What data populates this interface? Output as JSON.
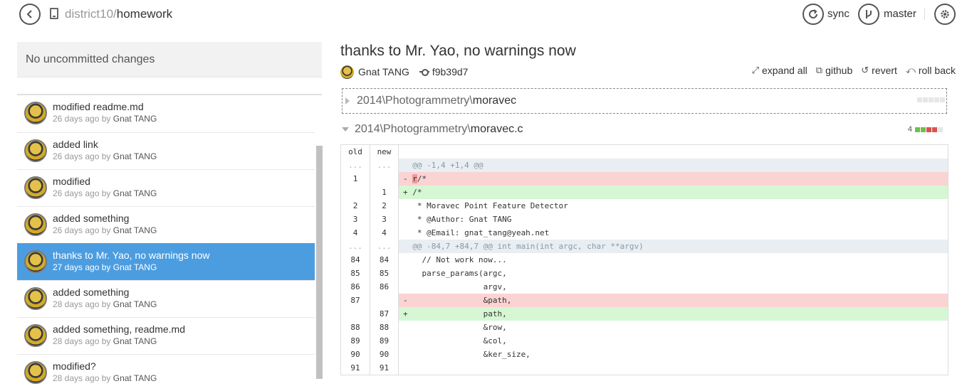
{
  "header": {
    "repo_owner": "district10",
    "repo_sep": "/",
    "repo_name": "homework",
    "sync_label": "sync",
    "branch_label": "master"
  },
  "sidebar": {
    "uncommitted": "No uncommitted changes",
    "commits": [
      {
        "message": "modified readme.md",
        "time": "26 days ago by ",
        "author": "Gnat TANG"
      },
      {
        "message": "added link",
        "time": "26 days ago by ",
        "author": "Gnat TANG"
      },
      {
        "message": "modified",
        "time": "26 days ago by ",
        "author": "Gnat TANG"
      },
      {
        "message": "added something",
        "time": "26 days ago by ",
        "author": "Gnat TANG"
      },
      {
        "message": "thanks to Mr. Yao, no warnings now",
        "time": "27 days ago by ",
        "author": "Gnat TANG"
      },
      {
        "message": "added something",
        "time": "28 days ago by ",
        "author": "Gnat TANG"
      },
      {
        "message": "added something, readme.md",
        "time": "28 days ago by ",
        "author": "Gnat TANG"
      },
      {
        "message": "modified?",
        "time": "28 days ago by ",
        "author": "Gnat TANG"
      }
    ]
  },
  "commit": {
    "title": "thanks to Mr. Yao, no warnings now",
    "author": "Gnat TANG",
    "sha": "f9b39d7",
    "actions": {
      "expand_all": "expand all",
      "github": "github",
      "revert": "revert",
      "roll_back": "roll back"
    }
  },
  "files": [
    {
      "dir": "2014\\Photogrammetry\\",
      "name": "moravec",
      "changes": ""
    },
    {
      "dir": "2014\\Photogrammetry\\",
      "name": "moravec.c",
      "changes": "4"
    }
  ],
  "diff": {
    "col_old": "old",
    "col_new": "new",
    "rows": [
      {
        "type": "hunk",
        "old": "...",
        "new": "...",
        "code": "  @@ -1,4 +1,4 @@"
      },
      {
        "type": "del",
        "old": "1",
        "new": "",
        "code_prefix": "- ",
        "code_hl": "r",
        "code_rest": "/*"
      },
      {
        "type": "add",
        "old": "",
        "new": "1",
        "code": "+ /*"
      },
      {
        "type": "ctx",
        "old": "2",
        "new": "2",
        "code": "   * Moravec Point Feature Detector"
      },
      {
        "type": "ctx",
        "old": "3",
        "new": "3",
        "code": "   * @Author: Gnat TANG"
      },
      {
        "type": "ctx",
        "old": "4",
        "new": "4",
        "code": "   * @Email: gnat_tang@yeah.net"
      },
      {
        "type": "hunk",
        "old": "...",
        "new": "...",
        "code": "  @@ -84,7 +84,7 @@ int main(int argc, char **argv)"
      },
      {
        "type": "ctx",
        "old": "84",
        "new": "84",
        "code": "    // Not work now..."
      },
      {
        "type": "ctx",
        "old": "85",
        "new": "85",
        "code": "    parse_params(argc,"
      },
      {
        "type": "ctx",
        "old": "86",
        "new": "86",
        "code": "                 argv,"
      },
      {
        "type": "del",
        "old": "87",
        "new": "",
        "code": "-                &path,"
      },
      {
        "type": "add",
        "old": "",
        "new": "87",
        "code": "+                path,"
      },
      {
        "type": "ctx",
        "old": "88",
        "new": "88",
        "code": "                 &row,"
      },
      {
        "type": "ctx",
        "old": "89",
        "new": "89",
        "code": "                 &col,"
      },
      {
        "type": "ctx",
        "old": "90",
        "new": "90",
        "code": "                 &ker_size,"
      },
      {
        "type": "ctx",
        "old": "91",
        "new": "91",
        "code": ""
      }
    ]
  },
  "colors": {
    "selected": "#4c9de0",
    "add_bg": "#d6f7d3",
    "del_bg": "#fbd3d3",
    "hunk_bg": "#e9eef2",
    "stat_add": "#6cc04a",
    "stat_del": "#d9534f"
  },
  "icons": [
    "back-icon",
    "repo-icon",
    "sync-icon",
    "branch-icon",
    "gear-icon",
    "expand-icon",
    "github-icon",
    "revert-icon",
    "rollback-icon",
    "commit-icon"
  ]
}
